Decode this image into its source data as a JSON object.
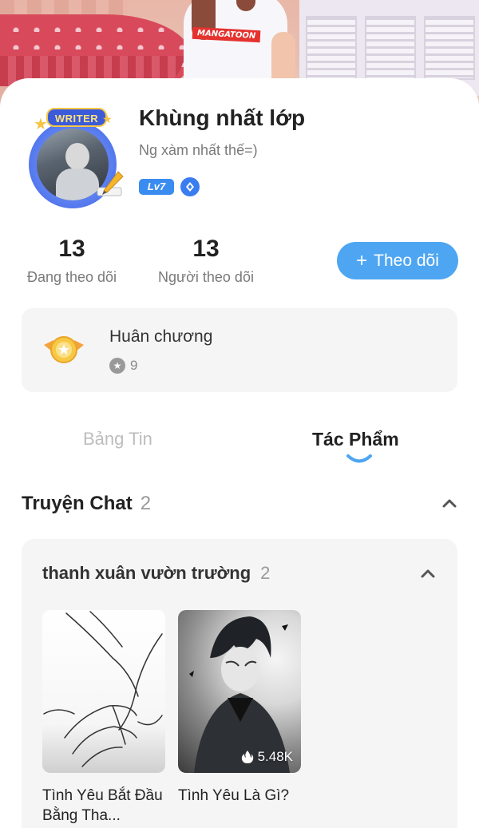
{
  "banner": {
    "brand_text": "MANGATOON"
  },
  "profile": {
    "badge_text": "WRITER",
    "name": "Khùng nhất lớp",
    "bio": "Ng xàm nhất thế=)",
    "level": "Lv7"
  },
  "stats": [
    {
      "value": "13",
      "label": "Đang theo dõi"
    },
    {
      "value": "13",
      "label": "Người theo dõi"
    }
  ],
  "follow_button": {
    "icon": "+",
    "label": "Theo dõi"
  },
  "medals": {
    "title": "Huân chương",
    "count": "9"
  },
  "tabs": [
    {
      "label": "Bảng Tin",
      "active": false
    },
    {
      "label": "Tác Phẩm",
      "active": true
    }
  ],
  "section": {
    "title": "Truyện Chat",
    "count": "2"
  },
  "group": {
    "title": "thanh xuân vườn trường",
    "count": "2",
    "books": [
      {
        "title": "Tình Yêu Bắt Đầu Bằng Tha...",
        "views": ""
      },
      {
        "title": "Tình Yêu Là Gì?",
        "views": "5.48K"
      }
    ]
  },
  "colors": {
    "accent": "#4ea6f2",
    "card_bg": "#f5f5f5",
    "level_badge": "#3a8cf0"
  }
}
